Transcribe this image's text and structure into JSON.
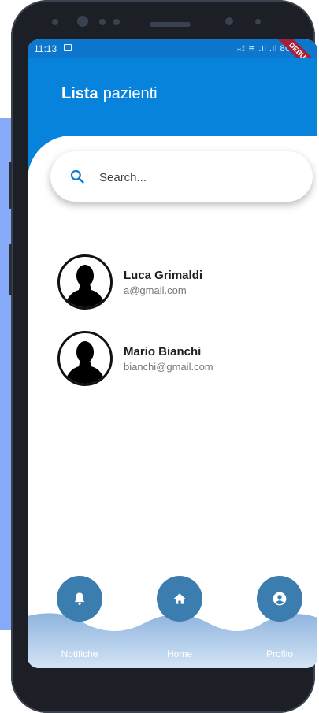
{
  "status_bar": {
    "time": "11:13",
    "right_text": "⁎⟟ ≋ .ıl .ıl 80%",
    "debug_label": "DEBUG"
  },
  "app_bar": {
    "title_bold": "Lista",
    "title_rest": "pazienti"
  },
  "search": {
    "placeholder": "Search..."
  },
  "patients": [
    {
      "name": "Luca Grimaldi",
      "email": "a@gmail.com"
    },
    {
      "name": "Mario Bianchi",
      "email": "bianchi@gmail.com"
    }
  ],
  "bottom_nav": [
    {
      "label": "Notifiche",
      "icon": "bell-icon"
    },
    {
      "label": "Home",
      "icon": "home-icon"
    },
    {
      "label": "Profilo",
      "icon": "account-circle-icon"
    }
  ],
  "colors": {
    "app_bar": "#0783dc",
    "status_bar": "#0d76cd",
    "nav_button": "#3c7db0",
    "wave_light": "#c9dcf2",
    "wave_dark": "#8fb4de"
  }
}
